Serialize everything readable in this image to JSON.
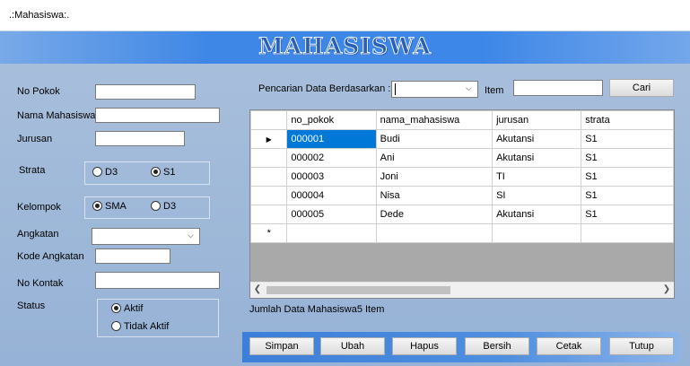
{
  "window": {
    "title": ".:Mahasiswa:."
  },
  "banner": {
    "title": "MAHASISWA"
  },
  "form": {
    "no_pokok_label": "No Pokok",
    "nama_label": "Nama Mahasiswa",
    "jurusan_label": "Jurusan",
    "strata_label": "Strata",
    "strata_options": [
      "D3",
      "S1"
    ],
    "strata_selected": "S1",
    "kelompok_label": "Kelompok",
    "kelompok_options": [
      "SMA",
      "D3"
    ],
    "kelompok_selected": "SMA",
    "angkatan_label": "Angkatan",
    "kode_angkatan_label": "Kode Angkatan",
    "no_kontak_label": "No Kontak",
    "status_label": "Status",
    "status_options": [
      "Aktif",
      "Tidak Aktif"
    ],
    "status_selected": "Aktif"
  },
  "search": {
    "label": "Pencarian Data Berdasarkan :",
    "item_label": "Item",
    "button": "Cari"
  },
  "grid": {
    "columns": [
      "no_pokok",
      "nama_mahasiswa",
      "jurusan",
      "strata"
    ],
    "rows": [
      [
        "000001",
        "Budi",
        "Akutansi",
        "S1"
      ],
      [
        "000002",
        "Ani",
        "Akutansi",
        "S1"
      ],
      [
        "000003",
        "Joni",
        "TI",
        "S1"
      ],
      [
        "000004",
        "Nisa",
        "SI",
        "S1"
      ],
      [
        "000005",
        "Dede",
        "Akutansi",
        "S1"
      ]
    ],
    "current_row_marker": "▶",
    "new_row_marker": "*"
  },
  "summary": "Jumlah Data Mahasiswa5 Item",
  "buttons": {
    "simpan": "Simpan",
    "ubah": "Ubah",
    "hapus": "Hapus",
    "bersih": "Bersih",
    "cetak": "Cetak",
    "tutup": "Tutup"
  }
}
